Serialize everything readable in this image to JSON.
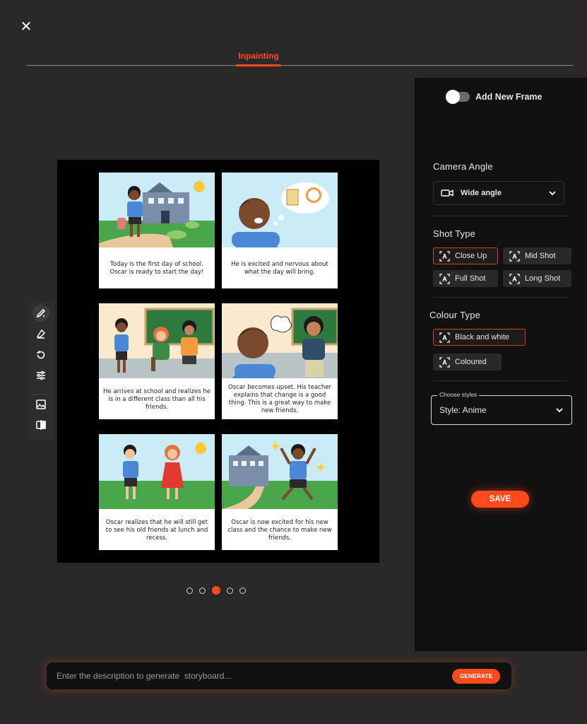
{
  "header": {
    "close_icon": "close-icon",
    "tab_label": "Inpainting",
    "accent": "#ff4a1c"
  },
  "toolbar": {
    "tools": [
      "pencil-sparkle-icon",
      "eraser-icon",
      "rotate-icon",
      "sliders-icon",
      "image-icon",
      "compare-icon"
    ],
    "active_tool": 0
  },
  "storyboard": {
    "panels": [
      {
        "caption": "Today is the first day of school. Oscar is ready to start the day!"
      },
      {
        "caption": "He is excited and nervous about what the day will bring."
      },
      {
        "caption": "He arrives at school and realizes he is in a different class than all his friends."
      },
      {
        "caption": "Oscar becomes upset. His teacher explains that change is a good thing. This is a great way to make new friends."
      },
      {
        "caption": "Oscar realizes that he will still get to see his old friends at lunch and recess."
      },
      {
        "caption": "Oscar is now excited for his new class and the chance to make new friends."
      }
    ],
    "pages": 5,
    "active_page": 3
  },
  "side_panel": {
    "add_frame_label": "Add New Frame",
    "add_frame_on": false,
    "camera_angle": {
      "title": "Camera Angle",
      "value": "Wide angle"
    },
    "shot_type": {
      "title": "Shot Type",
      "options": [
        "Close Up",
        "Mid Shot",
        "Full Shot",
        "Long Shot"
      ],
      "selected": "Close Up"
    },
    "colour_type": {
      "title": "Colour Type",
      "options": [
        "Black and white",
        "Coloured"
      ],
      "selected": "Black and white"
    },
    "styles": {
      "legend": "Choose styles",
      "value": "Style: Anime"
    },
    "save_label": "SAVE"
  },
  "prompt": {
    "placeholder": "Enter the description to generate  storyboard...",
    "generate_label": "GENERATE"
  }
}
